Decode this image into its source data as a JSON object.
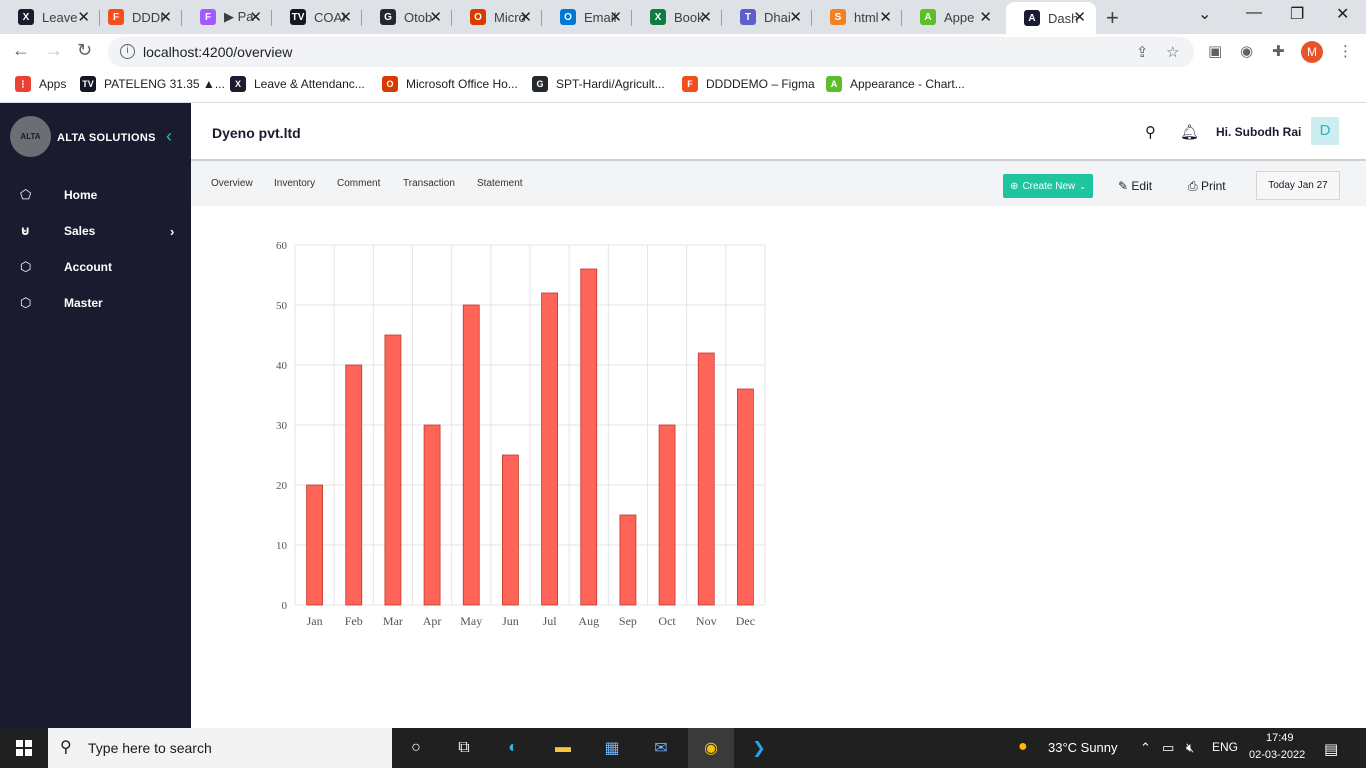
{
  "browser": {
    "tabs": [
      {
        "title": "Leave",
        "color": "#1a1b2e",
        "glyph": "X"
      },
      {
        "title": "DDDI",
        "color": "#f24e1e",
        "glyph": "F"
      },
      {
        "title": "▶ Pa",
        "color": "#a259ff",
        "glyph": "F"
      },
      {
        "title": "COAI",
        "color": "#131722",
        "glyph": "TV"
      },
      {
        "title": "Otob",
        "color": "#24292f",
        "glyph": "G"
      },
      {
        "title": "Micro",
        "color": "#d83b01",
        "glyph": "O"
      },
      {
        "title": "Email",
        "color": "#0078d4",
        "glyph": "O"
      },
      {
        "title": "Book",
        "color": "#107c41",
        "glyph": "X"
      },
      {
        "title": "Dhai",
        "color": "#5b5fc7",
        "glyph": "T"
      },
      {
        "title": "html",
        "color": "#f48024",
        "glyph": "S"
      },
      {
        "title": "Appe",
        "color": "#5cbf2a",
        "glyph": "A"
      },
      {
        "title": "Dash",
        "color": "#1a1b2e",
        "glyph": "A",
        "active": true
      }
    ],
    "url": "localhost:4200/overview",
    "profile_initial": "M",
    "bookmarks": [
      {
        "label": "Apps",
        "color": "#e94235",
        "glyph": "⋮"
      },
      {
        "label": "PATELENG 31.35 ▲...",
        "color": "#131722",
        "glyph": "TV"
      },
      {
        "label": "Leave & Attendanc...",
        "color": "#1a1b2e",
        "glyph": "X"
      },
      {
        "label": "Microsoft Office Ho...",
        "color": "#d83b01",
        "glyph": "O"
      },
      {
        "label": "SPT-Hardi/Agricult...",
        "color": "#24292f",
        "glyph": "G"
      },
      {
        "label": "DDDDEMO – Figma",
        "color": "#f24e1e",
        "glyph": "F"
      },
      {
        "label": "Appearance - Chart...",
        "color": "#5cbf2a",
        "glyph": "A"
      }
    ]
  },
  "sidebar": {
    "logo_text": "ALTA",
    "brand": "ALTA SOLUTIONS",
    "items": [
      {
        "label": "Home",
        "icon": "⬠"
      },
      {
        "label": "Sales",
        "icon": "⊌"
      },
      {
        "label": "Account",
        "icon": "⬡"
      },
      {
        "label": "Master",
        "icon": "⬡"
      }
    ]
  },
  "header": {
    "company": "Dyeno pvt.ltd",
    "greeting": "Hi. Subodh Rai",
    "avatar_initial": "D"
  },
  "subnav": {
    "tabs": [
      "Overview",
      "Inventory",
      "Comment",
      "Transaction",
      "Statement"
    ],
    "create_label": "Create New",
    "edit_label": "Edit",
    "print_label": "Print",
    "date_label": "Today  Jan 27"
  },
  "chart_data": {
    "type": "bar",
    "categories": [
      "Jan",
      "Feb",
      "Mar",
      "Apr",
      "May",
      "Jun",
      "Jul",
      "Aug",
      "Sep",
      "Oct",
      "Nov",
      "Dec"
    ],
    "values": [
      20,
      40,
      45,
      30,
      50,
      25,
      52,
      56,
      15,
      30,
      42,
      36
    ],
    "ylim": [
      0,
      60
    ],
    "yticks": [
      0,
      10,
      20,
      30,
      40,
      50,
      60
    ],
    "bar_color": "#ff6459",
    "bar_stroke": "#c0392b",
    "grid": true
  },
  "taskbar": {
    "search_placeholder": "Type here to search",
    "weather": "33°C  Sunny",
    "language": "ENG",
    "time": "17:49",
    "date": "02-03-2022",
    "notif_count": "1"
  }
}
